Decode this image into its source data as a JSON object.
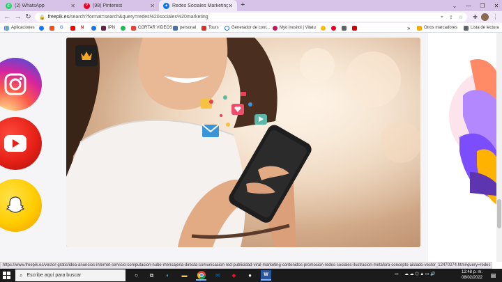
{
  "tabs": [
    {
      "label": "(2) WhatsApp",
      "color": "#25d366"
    },
    {
      "label": "(98) Pinterest",
      "color": "#e60023"
    },
    {
      "label": "Redes Sociales Marketing | Fotos",
      "color": "#1273eb"
    }
  ],
  "address": {
    "domain": "freepik.es",
    "path": "/search?format=search&query=redes%20sociales%20marketing"
  },
  "bookmarks": {
    "apps_label": "Aplicaciones",
    "items": [
      "IPN",
      "CORTAR VIDEOS",
      "personal",
      "Tours",
      "Generador de cont...",
      "Myo inositol | Vitatu"
    ],
    "more_label": "»",
    "other_label": "Otros marcadores",
    "reading_label": "Lista de lectura"
  },
  "status_url": "https://www.freepik.es/vector-gratis/idea-anuncios-internet-servicio-computacion-nube-mensajeria-directa-comunicacion-red-publicidad-viral-marketing-contenidos-promocion-redes-sociales-ilustracion-metafora-concepto-aislado-vector_12470274.htm#query=redes sociales ma...",
  "taskbar": {
    "search_placeholder": "Escribe aquí para buscar",
    "time": "12:48 p. m.",
    "date": "08/02/2022"
  },
  "colors": {
    "tab_strip": "#d7c3e8",
    "toolbar": "#f1e8f8",
    "instagram": "#d62976",
    "youtube": "#e62117",
    "snapchat": "#ffcc00",
    "crown_bg": "#1f1f1f",
    "crown": "#f5a623"
  }
}
